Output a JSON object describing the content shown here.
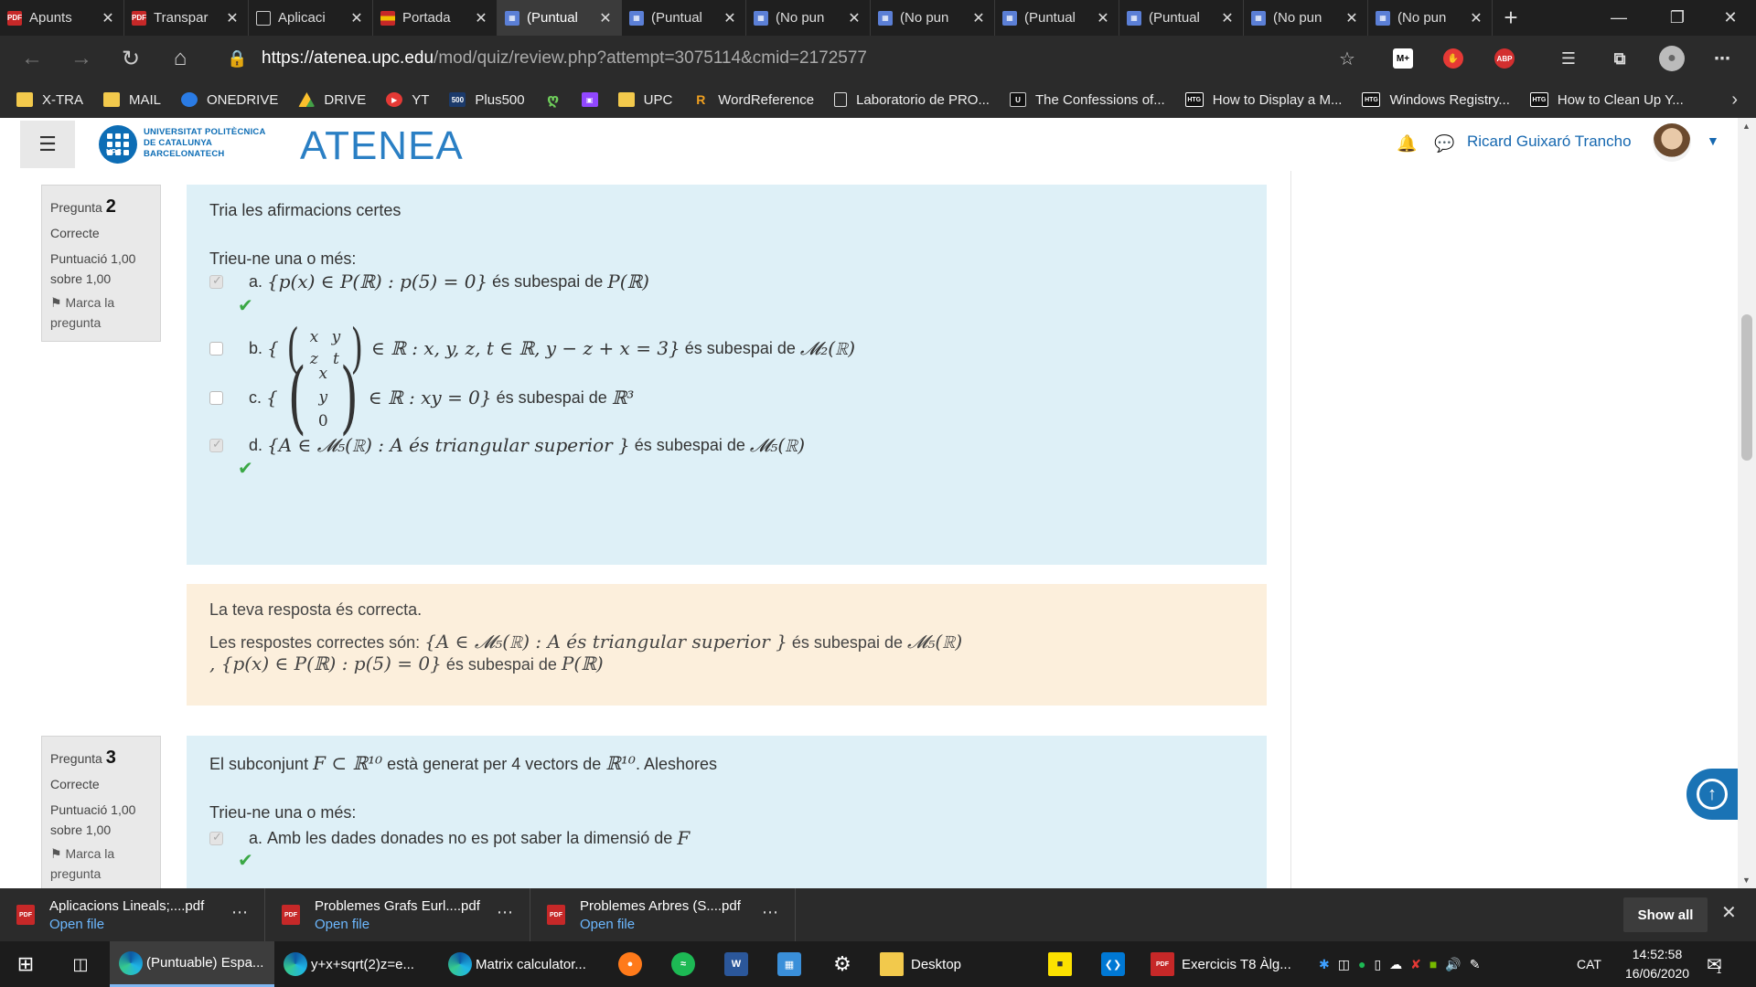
{
  "tabs": [
    {
      "label": "Apunts",
      "icon": "pdf-icon",
      "active": false
    },
    {
      "label": "Transpar",
      "icon": "pdf-icon",
      "active": false
    },
    {
      "label": "Aplicaci",
      "icon": "document-icon",
      "active": false
    },
    {
      "label": "Portada",
      "icon": "flag-icon",
      "active": false
    },
    {
      "label": "(Puntual",
      "icon": "upc-icon",
      "active": true
    },
    {
      "label": "(Puntual",
      "icon": "upc-icon",
      "active": false
    },
    {
      "label": "(No pun",
      "icon": "upc-icon",
      "active": false
    },
    {
      "label": "(No pun",
      "icon": "upc-icon",
      "active": false
    },
    {
      "label": "(Puntual",
      "icon": "upc-icon",
      "active": false
    },
    {
      "label": "(Puntual",
      "icon": "upc-icon",
      "active": false
    },
    {
      "label": "(No pun",
      "icon": "upc-icon",
      "active": false
    },
    {
      "label": "(No pun",
      "icon": "upc-icon",
      "active": false
    }
  ],
  "address": {
    "host": "https://atenea.upc.edu",
    "path": "/mod/quiz/review.php?attempt=3075114&cmid=2172577"
  },
  "extensions": [
    "M+",
    "ABP"
  ],
  "bookmarks": [
    {
      "label": "X-TRA",
      "icon": "folder-icon"
    },
    {
      "label": "MAIL",
      "icon": "folder-icon"
    },
    {
      "label": "ONEDRIVE",
      "icon": "onedrive-icon"
    },
    {
      "label": "DRIVE",
      "icon": "drive-icon"
    },
    {
      "label": "YT",
      "icon": "youtube-icon"
    },
    {
      "label": "Plus500",
      "icon": "plus500-icon"
    },
    {
      "label": "",
      "icon": "green-app-icon"
    },
    {
      "label": "",
      "icon": "twitch-icon"
    },
    {
      "label": "UPC",
      "icon": "folder-icon"
    },
    {
      "label": "WordReference",
      "icon": "wordreference-icon"
    },
    {
      "label": "Laboratorio de PRO...",
      "icon": "page-icon"
    },
    {
      "label": "The Confessions of...",
      "icon": "confessions-icon"
    },
    {
      "label": "How to Display a M...",
      "icon": "htg-icon"
    },
    {
      "label": "Windows Registry...",
      "icon": "htg-icon"
    },
    {
      "label": "How to Clean Up Y...",
      "icon": "htg-icon"
    }
  ],
  "header": {
    "upc_name": [
      "UNIVERSITAT POLITÈCNICA",
      "DE CATALUNYA",
      "BARCELONATECH"
    ],
    "upc_short": "UPC",
    "site_name": "ATENEA",
    "user_name": "Ricard Guixaró Trancho"
  },
  "q2": {
    "info": {
      "label": "Pregunta",
      "number": "2",
      "status": "Correcte",
      "score": "Puntuació 1,00 sobre 1,00",
      "flag": "Marca la pregunta"
    },
    "text": "Tria les afirmacions certes",
    "prompt": "Trieu-ne una o més:",
    "options": [
      {
        "letter": "a.",
        "math": "{p(x) ∈ P(ℝ) : p(5) = 0}",
        "suffix": "és subespai de",
        "target": "P(ℝ)",
        "checked": true,
        "correct": true
      },
      {
        "letter": "b.",
        "math_pre": "{",
        "matrix": [
          "x",
          "y",
          "z",
          "t"
        ],
        "math_post": "∈ ℝ : x, y, z, t ∈ ℝ,  y − z + x = 3}",
        "suffix": "és subespai de",
        "target": "𝓜₂(ℝ)",
        "checked": false,
        "correct": false
      },
      {
        "letter": "c.",
        "math_pre": "{",
        "vector": [
          "x",
          "y",
          "0"
        ],
        "math_post": "∈ ℝ : xy = 0}",
        "suffix": "és subespai de",
        "target": "ℝ³",
        "checked": false,
        "correct": false
      },
      {
        "letter": "d.",
        "math": "{A ∈ 𝓜₅(ℝ) : A és triangular superior }",
        "suffix": "és subespai de",
        "target": "𝓜₅(ℝ)",
        "checked": true,
        "correct": true
      }
    ]
  },
  "q2_feedback": {
    "line1": "La teva resposta és correcta.",
    "line2_label": "Les respostes correctes són:",
    "line2_math": "{A ∈ 𝓜₅(ℝ) : A és triangular superior }",
    "line2_suffix": "és subespai de",
    "line2_target": "𝓜₅(ℝ)",
    "line3_math": ", {p(x) ∈ P(ℝ) : p(5) = 0}",
    "line3_suffix": "és subespai de",
    "line3_target": "P(ℝ)"
  },
  "q3": {
    "info": {
      "label": "Pregunta",
      "number": "3",
      "status": "Correcte",
      "score": "Puntuació 1,00 sobre 1,00",
      "flag": "Marca la pregunta"
    },
    "text_pre": "El subconjunt",
    "text_math1": "F ⊂ ℝ¹⁰",
    "text_mid": "està generat per 4 vectors de",
    "text_math2": "ℝ¹⁰",
    "text_post": ". Aleshores",
    "prompt": "Trieu-ne una o més:",
    "option_a": {
      "letter": "a.",
      "text": "Amb les dades donades no es pot saber la dimensió de",
      "math": "F",
      "checked": true,
      "correct": true
    }
  },
  "downloads": [
    {
      "name": "Aplicacions Lineals;....pdf",
      "action": "Open file"
    },
    {
      "name": "Problemes Grafs Eurl....pdf",
      "action": "Open file"
    },
    {
      "name": "Problemes Arbres (S....pdf",
      "action": "Open file"
    }
  ],
  "downloads_show_all": "Show all",
  "taskbar": {
    "apps": [
      {
        "label": "(Puntuable) Espa...",
        "icon": "edge-icon",
        "active": true
      },
      {
        "label": "y+x+sqrt(2)z=e...",
        "icon": "edge-icon",
        "active": false
      },
      {
        "label": "Matrix calculator...",
        "icon": "edge-icon",
        "active": false
      }
    ],
    "desktop_label": "Desktop",
    "exercise_label": "Exercicis T8 Àlg...",
    "language": "CAT",
    "time": "14:52:58",
    "date": "16/06/2020",
    "notification_count": "1"
  }
}
